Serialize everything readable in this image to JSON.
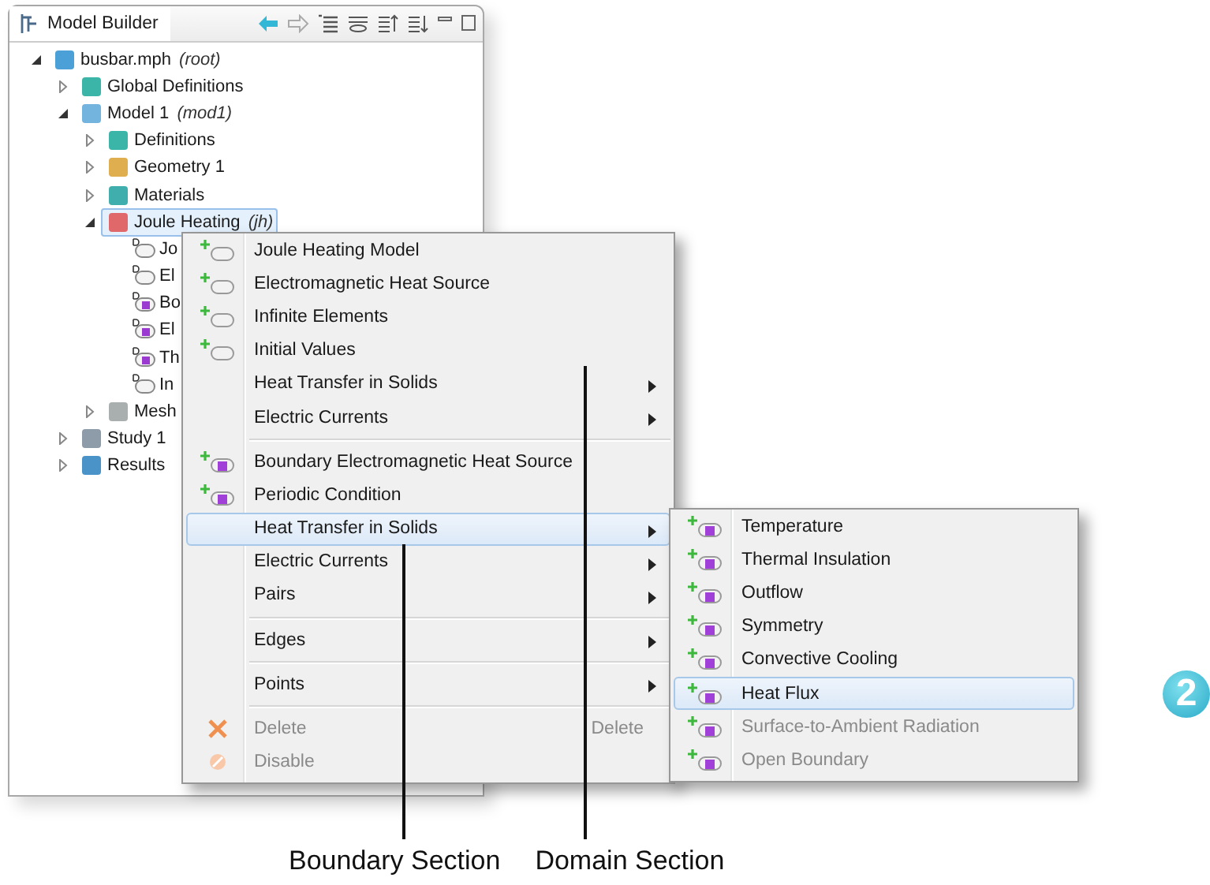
{
  "panel": {
    "title": "Model Builder"
  },
  "tree": [
    {
      "label": "busbar.mph",
      "note": "(root)",
      "kind": "root",
      "expanded": true,
      "selected": false,
      "children": [
        {
          "label": "Global Definitions",
          "kind": "definitions",
          "expanded": false,
          "selected": false
        },
        {
          "label": "Model 1",
          "note": "(mod1)",
          "kind": "model",
          "expanded": true,
          "selected": false,
          "children": [
            {
              "label": "Definitions",
              "kind": "definitions",
              "expanded": false,
              "selected": false
            },
            {
              "label": "Geometry 1",
              "kind": "geometry",
              "expanded": false,
              "selected": false
            },
            {
              "label": "Materials",
              "kind": "materials",
              "expanded": false,
              "selected": false
            },
            {
              "label": "Joule Heating",
              "note": "(jh)",
              "kind": "physics",
              "expanded": true,
              "selected": true,
              "children": [
                {
                  "label": "Jo",
                  "kind": "domain",
                  "selected": false
                },
                {
                  "label": "El",
                  "kind": "domain",
                  "selected": false
                },
                {
                  "label": "Bo",
                  "kind": "boundary",
                  "selected": false
                },
                {
                  "label": "El",
                  "kind": "boundary",
                  "selected": false
                },
                {
                  "label": "Th",
                  "kind": "boundary",
                  "selected": false
                },
                {
                  "label": "In",
                  "kind": "domain",
                  "selected": false
                }
              ]
            },
            {
              "label": "Mesh",
              "kind": "mesh",
              "expanded": false,
              "selected": false
            }
          ]
        },
        {
          "label": "Study 1",
          "kind": "study",
          "expanded": false,
          "selected": false
        },
        {
          "label": "Results",
          "kind": "results",
          "expanded": false,
          "selected": false
        }
      ]
    }
  ],
  "context_menu": [
    {
      "kind": "domain",
      "label": "Joule Heating Model",
      "selected": false
    },
    {
      "kind": "domain",
      "label": "Electromagnetic Heat Source",
      "selected": false
    },
    {
      "kind": "domain",
      "label": "Infinite Elements",
      "selected": false
    },
    {
      "kind": "domain",
      "label": "Initial Values",
      "selected": false
    },
    {
      "kind": "submenu",
      "label": "Heat Transfer in Solids",
      "selected": false
    },
    {
      "kind": "submenu",
      "label": "Electric Currents",
      "selected": false
    },
    {
      "kind": "separator"
    },
    {
      "kind": "boundary",
      "label": "Boundary Electromagnetic Heat Source",
      "selected": false
    },
    {
      "kind": "boundary",
      "label": "Periodic Condition",
      "selected": false
    },
    {
      "kind": "submenu",
      "label": "Heat Transfer in Solids",
      "selected": true
    },
    {
      "kind": "submenu",
      "label": "Electric Currents",
      "selected": false
    },
    {
      "kind": "submenu",
      "label": "Pairs",
      "selected": false
    },
    {
      "kind": "separator"
    },
    {
      "kind": "submenu",
      "label": "Edges",
      "selected": false
    },
    {
      "kind": "separator"
    },
    {
      "kind": "submenu",
      "label": "Points",
      "selected": false
    },
    {
      "kind": "separator"
    },
    {
      "kind": "delete",
      "label": "Delete",
      "shortcut": "Delete",
      "selected": false
    },
    {
      "kind": "disable",
      "label": "Disable",
      "selected": false
    }
  ],
  "submenu": [
    {
      "label": "Temperature",
      "selected": false
    },
    {
      "label": "Thermal Insulation",
      "selected": false
    },
    {
      "label": "Outflow",
      "selected": false
    },
    {
      "label": "Symmetry",
      "selected": false
    },
    {
      "label": "Convective Cooling",
      "selected": false
    },
    {
      "label": "Heat Flux",
      "selected": true
    },
    {
      "label": "Surface-to-Ambient Radiation",
      "selected": false
    },
    {
      "label": "Open Boundary",
      "selected": false
    }
  ],
  "step_badge": "2",
  "callouts": [
    {
      "label": "Boundary Section"
    },
    {
      "label": "Domain Section"
    }
  ]
}
